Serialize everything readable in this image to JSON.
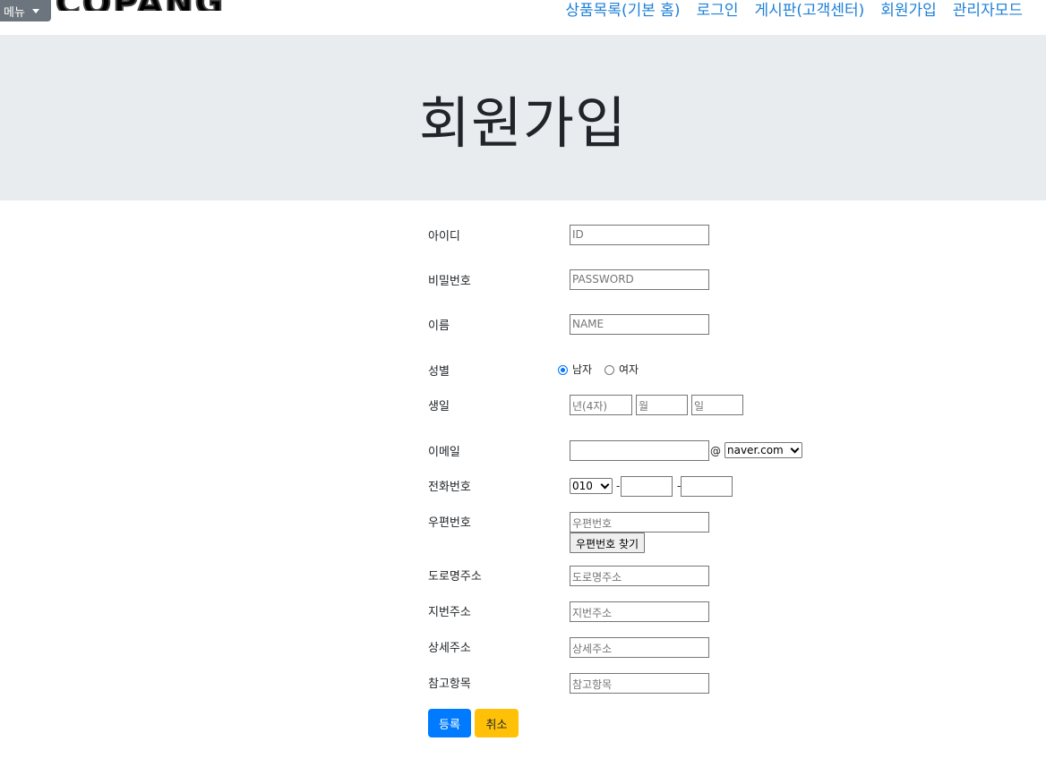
{
  "header": {
    "menu_label": "메뉴",
    "logo_text": "COPANG",
    "nav": [
      "상품목록(기본 홈)",
      "로그인",
      "게시판(고객센터)",
      "회원가입",
      "관리자모드"
    ],
    "link_color": "#1e80d8"
  },
  "jumbotron": {
    "title": "회원가입",
    "background": "#e9ecef"
  },
  "form": {
    "id": {
      "label": "아이디",
      "placeholder": "ID"
    },
    "password": {
      "label": "비밀번호",
      "placeholder": "PASSWORD"
    },
    "name": {
      "label": "이름",
      "placeholder": "NAME"
    },
    "gender": {
      "label": "성별",
      "options": [
        "남자",
        "여자"
      ],
      "selected": "남자"
    },
    "birth": {
      "label": "생일",
      "year_placeholder": "년(4자)",
      "month_placeholder": "월",
      "day_placeholder": "일"
    },
    "email": {
      "label": "이메일",
      "value": "",
      "at": "@",
      "domain_selected": "naver.com"
    },
    "phone": {
      "label": "전화번호",
      "prefix_selected": "010",
      "dash": "-"
    },
    "postcode": {
      "label": "우편번호",
      "placeholder": "우편번호",
      "find_button": "우편번호 찾기"
    },
    "road_address": {
      "label": "도로명주소",
      "placeholder": "도로명주소"
    },
    "jibun_address": {
      "label": "지번주소",
      "placeholder": "지번주소"
    },
    "detail_address": {
      "label": "상세주소",
      "placeholder": "상세주소"
    },
    "extra": {
      "label": "참고항목",
      "placeholder": "참고항목"
    },
    "submit_label": "등록",
    "cancel_label": "취소",
    "primary_color": "#007bff",
    "warning_color": "#ffc107"
  }
}
